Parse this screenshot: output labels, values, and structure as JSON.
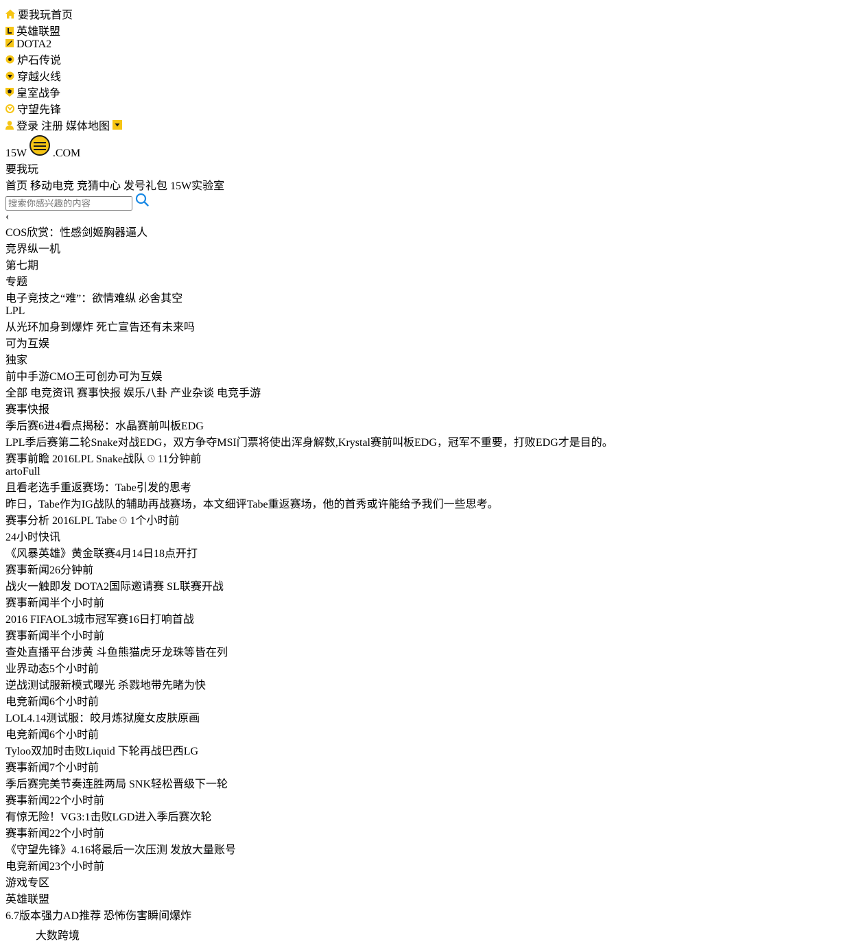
{
  "colors": {
    "accent": "#1a8ae5",
    "topbar": "#1b1b1b",
    "yellow": "#ffd700",
    "tagblue": "#3b8fd9"
  },
  "topbar": {
    "items": [
      {
        "label": "要我玩首页",
        "icon": "home-icon"
      },
      {
        "label": "英雄联盟",
        "icon": "lol-icon"
      },
      {
        "label": "DOTA2",
        "icon": "dota2-icon"
      },
      {
        "label": "炉石传说",
        "icon": "hearthstone-icon"
      },
      {
        "label": "穿越火线",
        "icon": "crossfire-icon"
      },
      {
        "label": "皇室战争",
        "icon": "clash-royale-icon"
      },
      {
        "label": "守望先锋",
        "icon": "overwatch-icon"
      }
    ],
    "login": "登录",
    "register": "注册",
    "media_map": "媒体地图"
  },
  "header": {
    "logo_main": "15W",
    "logo_dot": ".COM",
    "logo_tag": "要我玩",
    "nav": [
      "首页",
      "移动电竞",
      "竞猜中心",
      "发号礼包",
      "15W实验室"
    ],
    "search_placeholder": "搜索你感兴趣的内容"
  },
  "slider": {
    "caption": "COS欣赏：性感剑姬胸器逼人"
  },
  "featured": {
    "top": {
      "badge": "专题",
      "banner": "竞界纵一机",
      "issue": "第七期",
      "caption": "电子竞技之“难”：欲情难纵 必舍其空"
    },
    "left": {
      "badge": "LPL",
      "caption": "从光环加身到爆炸 死亡宣告还有未来吗"
    },
    "right": {
      "badge": "独家",
      "caption": "前中手游CMO王可创办可为互娱",
      "logo": "可为互娱"
    }
  },
  "tabs": [
    "全部",
    "电竞资讯",
    "赛事快报",
    "娱乐八卦",
    "产业杂谈",
    "电竞手游"
  ],
  "tooltip": "赛事快报",
  "articles": [
    {
      "title": "季后赛6进4看点揭秘：水晶赛前叫板EDG",
      "summary": "LPL季后赛第二轮Snake对战EDG，双方争夺MSI门票将使出浑身解数,Krystal赛前叫板EDG，冠军不重要，打败EDG才是目的。",
      "tags": [
        "赛事前瞻",
        "2016LPL",
        "Snake战队"
      ],
      "time": "11分钟前"
    },
    {
      "title": "且看老选手重返赛场：Tabe引发的思考",
      "summary": "昨日，Tabe作为IG战队的辅助再战赛场，本文细评Tabe重返赛场，他的首秀或许能给予我们一些思考。",
      "tags": [
        "赛事分析",
        "2016LPL",
        "Tabe"
      ],
      "time": "1个小时前"
    }
  ],
  "news": {
    "title": "24小时快讯",
    "items": [
      {
        "title": "《风暴英雄》黄金联赛4月14日18点开打",
        "cat": "赛事新闻",
        "time": "26分钟前"
      },
      {
        "title": "战火一触即发 DOTA2国际邀请赛 SL联赛开战",
        "cat": "赛事新闻",
        "time": "半个小时前"
      },
      {
        "title": "2016 FIFAOL3城市冠军赛16日打响首战",
        "cat": "赛事新闻",
        "time": "半个小时前"
      },
      {
        "title": "查处直播平台涉黄 斗鱼熊猫虎牙龙珠等皆在列",
        "cat": "业界动态",
        "time": "5个小时前"
      },
      {
        "title": "逆战测试服新模式曝光 杀戮地带先睹为快",
        "cat": "电竞新闻",
        "time": "6个小时前"
      },
      {
        "title": "LOL4.14测试服：皎月炼狱魔女皮肤原画",
        "cat": "电竞新闻",
        "time": "6个小时前"
      },
      {
        "title": "Tyloo双加时击败Liquid 下轮再战巴西LG",
        "cat": "赛事新闻",
        "time": "7个小时前"
      },
      {
        "title": "季后赛完美节奏连胜两局 SNK轻松晋级下一轮",
        "cat": "赛事新闻",
        "time": "22个小时前"
      },
      {
        "title": "有惊无险！VG3:1击败LGD进入季后赛次轮",
        "cat": "赛事新闻",
        "time": "22个小时前"
      },
      {
        "title": "《守望先锋》4.16将最后一次压测 发放大量账号",
        "cat": "电竞新闻",
        "time": "23个小时前"
      }
    ]
  },
  "games": {
    "title": "游戏专区",
    "item_title": "6.7版本强力AD推荐 恐怖伤害瞬间爆炸",
    "logo_text": "英雄联盟"
  },
  "watermark": "大数跨境"
}
